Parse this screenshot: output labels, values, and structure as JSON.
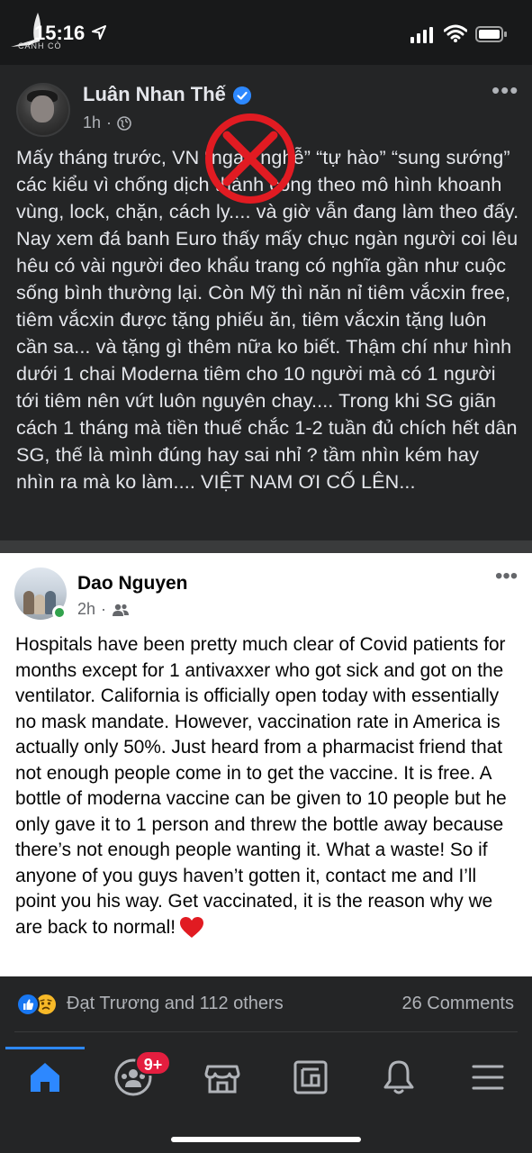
{
  "status_bar": {
    "time": "15:16",
    "watermark": "CÁNH CÒ"
  },
  "post1": {
    "author": "Luân Nhan Thế",
    "time": "1h",
    "body": "Mấy tháng trước, VN “ngạo nghễ” “tự hào” “sung sướng” các kiểu vì chống dịch thành công theo mô hình khoanh vùng, lock, chặn, cách ly.... và giờ vẫn đang làm theo đấy. Nay xem đá banh Euro thấy mấy chục ngàn người coi lêu hêu có vài người đeo khẩu trang có nghĩa gần như cuộc sống bình thường lại. Còn Mỹ thì năn nỉ tiêm vắcxin free, tiêm vắcxin được tặng phiếu ăn, tiêm vắcxin tặng luôn cần sa... và tặng gì thêm nữa ko biết. Thậm chí như hình dưới 1 chai Moderna tiêm cho 10 người mà có 1 người tới tiêm nên vứt luôn nguyên chay.... Trong khi SG giãn cách 1 tháng mà tiền thuế chắc 1-2 tuần đủ chích hết dân SG, thế là mình đúng hay sai nhỉ ? tầm nhìn kém hay nhìn ra mà ko làm.... VIỆT NAM ƠI CỐ LÊN..."
  },
  "post2": {
    "author": "Dao Nguyen",
    "time": "2h",
    "body": "Hospitals have been pretty much clear of Covid patients for months except for 1 antivaxxer who got sick and got on the ventilator. California is officially open today with essentially no mask mandate. However, vaccination rate in America is actually only 50%. Just heard from a pharmacist friend that not enough people come in to get the vaccine. It is free. A bottle of moderna vaccine can be given to 10 people but he only gave it to 1 person and threw the bottle away because there’s not enough people wanting it. What a waste! So if anyone of you guys haven’t gotten it, contact me and I’ll point you his way. Get vaccinated, it is the reason why we are back to normal!",
    "reactions_text": "Đạt Trương and 112 others",
    "comments_text": "26 Comments"
  },
  "nav": {
    "badge": "9+",
    "items": [
      "home-icon",
      "groups-icon",
      "marketplace-icon",
      "news-feed-icon",
      "notifications-icon",
      "menu-icon"
    ]
  },
  "colors": {
    "accent": "#2d88ff",
    "badge": "#e41e3f",
    "dark_bg": "#242526",
    "stamp": "#e11b22"
  }
}
